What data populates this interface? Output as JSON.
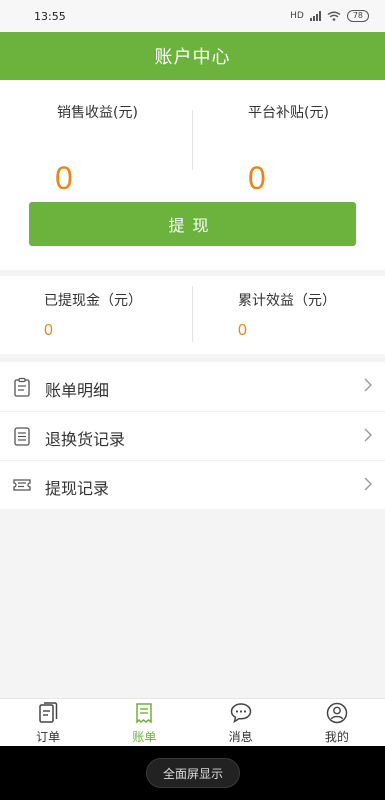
{
  "status": {
    "time": "13:55",
    "battery": "78",
    "network": "HD"
  },
  "header": {
    "title": "账户中心"
  },
  "earnings": {
    "sales_label": "销售收益(元)",
    "sales_value": "0",
    "subsidy_label": "平台补贴(元)",
    "subsidy_value": "0",
    "withdraw_button": "提现"
  },
  "summary": {
    "withdrawn_label": "已提现金（元）",
    "withdrawn_value": "0",
    "cumulative_label": "累计效益（元）",
    "cumulative_value": "0"
  },
  "menu": {
    "items": [
      {
        "label": "账单明细",
        "icon": "clipboard-icon"
      },
      {
        "label": "退换货记录",
        "icon": "list-icon"
      },
      {
        "label": "提现记录",
        "icon": "ticket-icon"
      }
    ]
  },
  "tabbar": {
    "items": [
      {
        "label": "订单",
        "icon": "orders-icon"
      },
      {
        "label": "账单",
        "icon": "bill-icon",
        "active": true
      },
      {
        "label": "消息",
        "icon": "message-icon"
      },
      {
        "label": "我的",
        "icon": "profile-icon"
      }
    ]
  },
  "system": {
    "fullscreen_label": "全面屏显示"
  },
  "colors": {
    "accent": "#6cb33e",
    "amount": "#e8861b"
  }
}
